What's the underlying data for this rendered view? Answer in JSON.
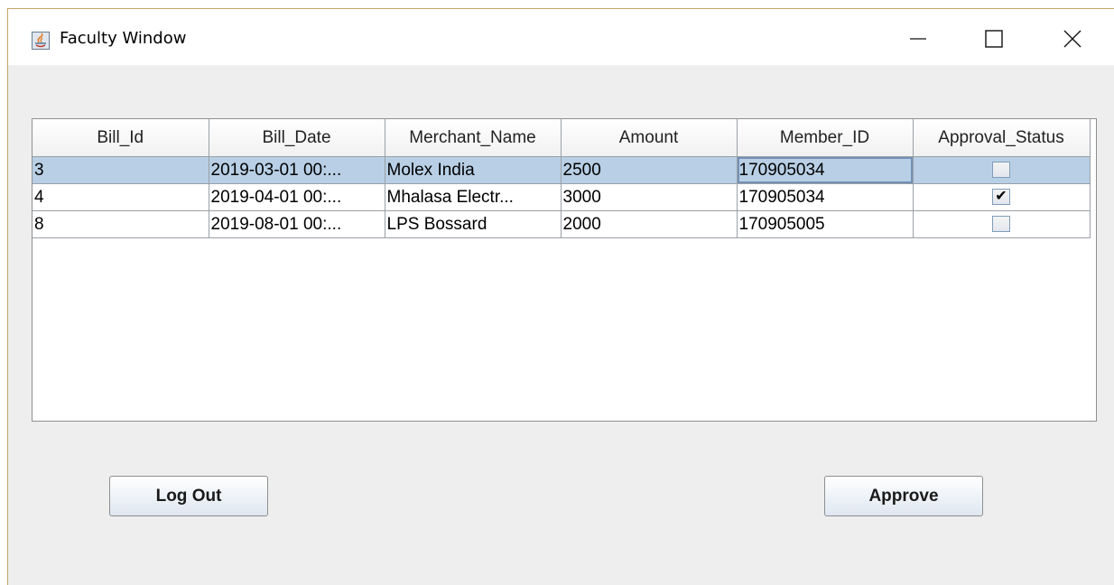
{
  "window": {
    "title": "Faculty Window",
    "icon": "java-app-icon",
    "controls": {
      "minimize": "minimize-icon",
      "maximize": "maximize-icon",
      "close": "close-icon"
    }
  },
  "table": {
    "headers": [
      "Bill_Id",
      "Bill_Date",
      "Merchant_Name",
      "Amount",
      "Member_ID",
      "Approval_Status"
    ],
    "rows": [
      {
        "bill_id": "3",
        "bill_date": "2019-03-01 00:...",
        "merchant": "Molex India",
        "amount": "2500",
        "member_id": "170905034",
        "approved": false,
        "selected": true
      },
      {
        "bill_id": "4",
        "bill_date": "2019-04-01 00:...",
        "merchant": "Mhalasa Electr...",
        "amount": "3000",
        "member_id": "170905034",
        "approved": true,
        "selected": false
      },
      {
        "bill_id": "8",
        "bill_date": "2019-08-01 00:...",
        "merchant": "LPS Bossard",
        "amount": "2000",
        "member_id": "170905005",
        "approved": false,
        "selected": false
      }
    ]
  },
  "buttons": {
    "logout_label": "Log Out",
    "approve_label": "Approve"
  },
  "colors": {
    "selection": "#b8cfe5",
    "window_bg": "#eeeeee"
  }
}
